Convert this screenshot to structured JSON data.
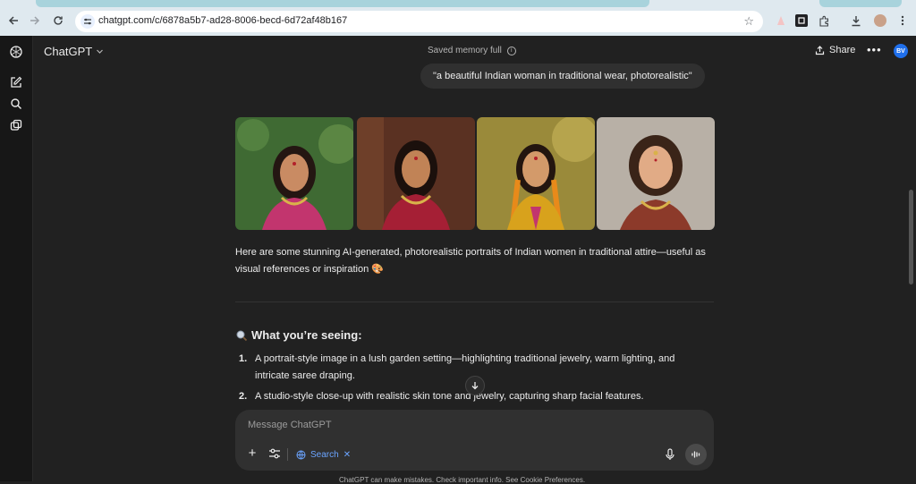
{
  "browser": {
    "url": "chatgpt.com/c/6878a5b7-ad28-8006-becd-6d72af48b167",
    "back_icon": "arrow-left-icon",
    "forward_icon": "arrow-right-icon",
    "reload_icon": "reload-icon",
    "accent": "#dfe9ef"
  },
  "header": {
    "app_title": "ChatGPT",
    "memory_status": "Saved memory full",
    "share_label": "Share",
    "avatar_initials": "BV"
  },
  "conversation": {
    "user_message": "\"a beautiful Indian woman in traditional wear, photorealistic\"",
    "images": [
      {
        "name": "portrait-1",
        "bg": "#3f6a33",
        "skin": "#c98b63",
        "dress": "#c2356e"
      },
      {
        "name": "portrait-2",
        "bg": "#5a3122",
        "skin": "#c18356",
        "dress": "#a51f35"
      },
      {
        "name": "portrait-3",
        "bg": "#9a8a3a",
        "skin": "#d39a6a",
        "dress": "#d8a21c"
      },
      {
        "name": "portrait-4",
        "bg": "#b8b0a6",
        "skin": "#e1ab86",
        "dress": "#8c3a2a"
      }
    ],
    "intro": "Here are some stunning AI-generated, photorealistic portraits of Indian women in traditional attire—useful as visual references or inspiration 🎨",
    "section_heading": "What you’re seeing:",
    "list_items": [
      {
        "num": "1.",
        "text": "A portrait-style image in a lush garden setting—highlighting traditional jewelry, warm lighting, and intricate saree draping."
      },
      {
        "num": "2.",
        "text": "A studio-style close-up with realistic skin tone and jewelry, capturing sharp facial features."
      }
    ]
  },
  "composer": {
    "placeholder": "Message ChatGPT",
    "search_label": "Search",
    "search_color": "#6ba4ff"
  },
  "footer": {
    "text": "ChatGPT can make mistakes. Check important info. See Cookie Preferences."
  }
}
